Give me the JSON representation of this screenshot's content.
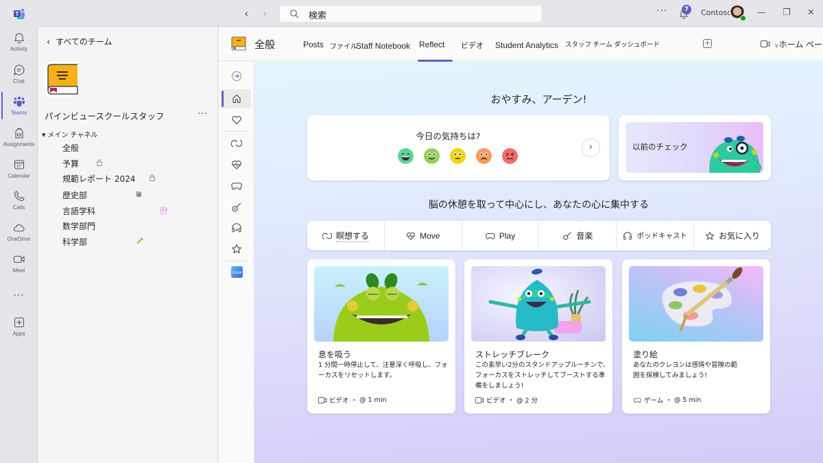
{
  "titlebar": {
    "search_placeholder": "検索",
    "more_label": "···",
    "notification_count": "7",
    "org_name": "Contoso",
    "window": {
      "minimize": "—",
      "maximize": "❐",
      "close": "✕"
    }
  },
  "rail": {
    "items": [
      {
        "label": "Activity",
        "icon": "bell-icon"
      },
      {
        "label": "Chat",
        "icon": "chat-icon"
      },
      {
        "label": "Teams",
        "icon": "teams-icon",
        "active": true
      },
      {
        "label": "Assignments",
        "icon": "backpack-icon"
      },
      {
        "label": "Calendar",
        "icon": "calendar-icon"
      },
      {
        "label": "Calls",
        "icon": "phone-icon"
      },
      {
        "label": "OneDrive",
        "icon": "cloud-icon"
      },
      {
        "label": "Meet",
        "icon": "video-icon"
      },
      {
        "label": "···",
        "icon": "more-icon"
      },
      {
        "label": "Apps",
        "icon": "apps-icon"
      }
    ],
    "accent": "#5b5fc7"
  },
  "team_panel": {
    "back_label": "すべてのチーム",
    "team_name": "パインビュースクールスタッフ",
    "more_label": "···",
    "channel_group": "メイン チャネル",
    "channels": [
      {
        "name": "全般",
        "icon": ""
      },
      {
        "name": "予算",
        "icon": "lock-icon"
      },
      {
        "name": "規範レポート 2024",
        "icon": "lock-icon"
      },
      {
        "name": "歴史部",
        "icon": "scroll-icon"
      },
      {
        "name": "言語学科",
        "icon": "notebook-icon"
      },
      {
        "name": "数学部門",
        "icon": ""
      },
      {
        "name": "科学部",
        "icon": "test-tube-icon"
      }
    ]
  },
  "tabbar": {
    "channel": "全般",
    "tabs": [
      {
        "label": "Posts"
      },
      {
        "label": "ファイル"
      },
      {
        "label": "Staff Notebook"
      },
      {
        "label": "Reflect",
        "active": true
      },
      {
        "label": "ビデオ"
      },
      {
        "label": "Student Analytics"
      },
      {
        "label": "スタッフ チーム ダッシュボード"
      }
    ],
    "add_label": "+",
    "home_label": "ホーム ページ"
  },
  "reflect_nav": [
    {
      "icon": "expand-icon"
    },
    {
      "icon": "home-icon",
      "active": true
    },
    {
      "icon": "heart-icon"
    },
    {
      "icon": "meditate-icon"
    },
    {
      "icon": "heartbeat-icon"
    },
    {
      "icon": "gamepad-icon"
    },
    {
      "icon": "guitar-icon"
    },
    {
      "icon": "headphones-icon"
    },
    {
      "icon": "star-icon"
    },
    {
      "icon": "calm-app-icon"
    }
  ],
  "reflect": {
    "greeting": "おやすみ、アーデン!",
    "checkin_question": "今日の気持ちは?",
    "emotions": [
      {
        "name": "great",
        "color": "#5fd39a"
      },
      {
        "name": "good",
        "color": "#98d05b"
      },
      {
        "name": "okay",
        "color": "#f2d20c"
      },
      {
        "name": "not-great",
        "color": "#ff9a5c"
      },
      {
        "name": "bad",
        "color": "#f86a6a"
      }
    ],
    "previous_checkin": "以前のチェック",
    "subheading": "脳の休憩を取って中心にし、あなたの心に集中する",
    "categories": [
      {
        "label": "瞑想する",
        "icon": "meditate-icon"
      },
      {
        "label": "Move",
        "icon": "heartbeat-icon"
      },
      {
        "label": "Play",
        "icon": "gamepad-icon"
      },
      {
        "label": "音楽",
        "icon": "guitar-icon"
      },
      {
        "label": "ポッドキャスト",
        "icon": "headphones-icon"
      },
      {
        "label": "お気に入り",
        "icon": "star-icon"
      }
    ],
    "activities": [
      {
        "title": "息を吸う",
        "description": "1 分間一時停止して、注意深く呼吸し、フォーカスをリセットします。",
        "type": "ビデオ",
        "duration": "@ 1 min",
        "meta_icon": "video-icon"
      },
      {
        "title": "ストレッチブレーク",
        "description": "この素早い2分のスタンドアップルーチンで、フォーカスをストレッチしてブーストする準備をしましょう!",
        "type": "ビデオ",
        "duration": "@ 2 分",
        "meta_icon": "video-icon"
      },
      {
        "title": "塗り絵",
        "description": "あなたのクレヨンは感情や冒険の範囲を探検してみましょう!",
        "type": "ゲーム",
        "duration": "@ 5 min",
        "meta_icon": "gamepad-icon"
      }
    ]
  }
}
